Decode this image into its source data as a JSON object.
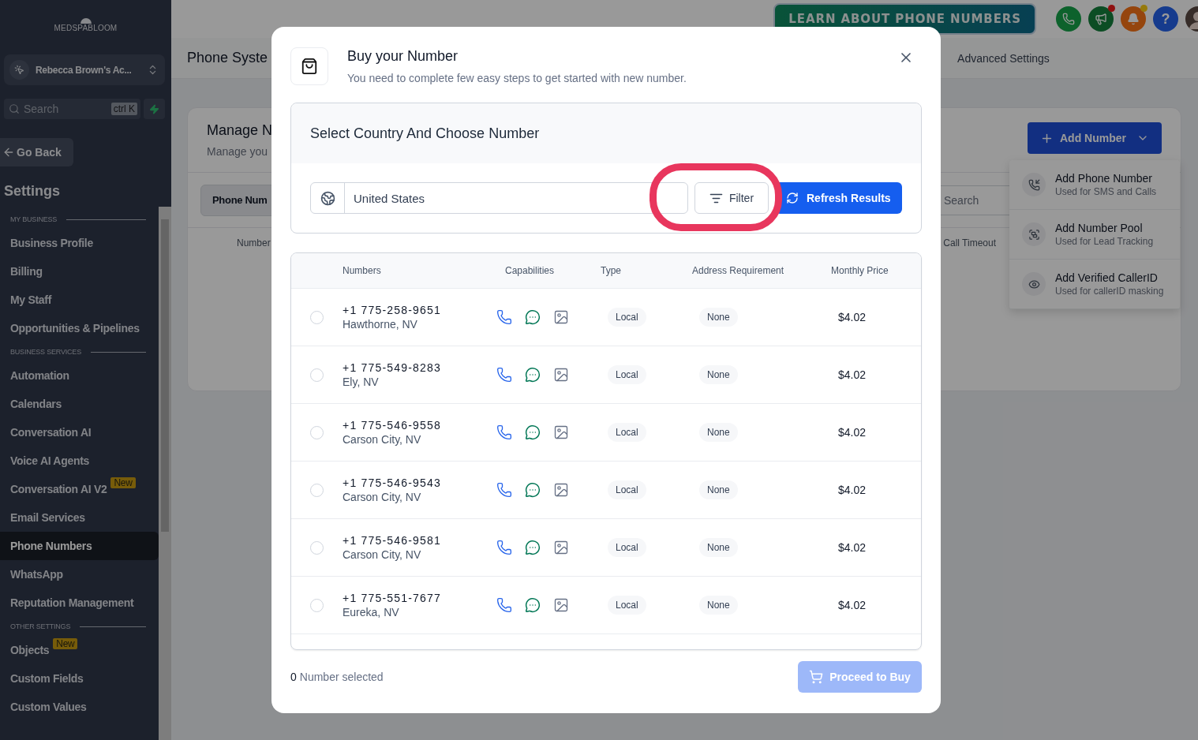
{
  "sidebar": {
    "logo": "MEDSPABLOOM",
    "account": "Rebecca Brown's Ac...",
    "search": {
      "placeholder": "Search",
      "shortcut": "ctrl K"
    },
    "back": "Go Back",
    "title": "Settings",
    "sections": [
      {
        "heading": "MY BUSINESS",
        "items": [
          {
            "label": "Business Profile",
            "selected": false
          },
          {
            "label": "Billing",
            "selected": false
          },
          {
            "label": "My Staff",
            "selected": false
          },
          {
            "label": "Opportunities & Pipelines",
            "selected": false
          }
        ]
      },
      {
        "heading": "BUSINESS SERVICES",
        "items": [
          {
            "label": "Automation",
            "selected": false
          },
          {
            "label": "Calendars",
            "selected": false
          },
          {
            "label": "Conversation AI",
            "selected": false
          },
          {
            "label": "Voice AI Agents",
            "selected": false
          },
          {
            "label": "Conversation AI V2",
            "badge": "New",
            "selected": false
          },
          {
            "label": "Email Services",
            "selected": false
          },
          {
            "label": "Phone Numbers",
            "selected": true
          },
          {
            "label": "WhatsApp",
            "selected": false
          },
          {
            "label": "Reputation Management",
            "selected": false
          }
        ]
      },
      {
        "heading": "OTHER SETTINGS",
        "items": [
          {
            "label": "Objects",
            "badge": "New",
            "selected": false
          },
          {
            "label": "Custom Fields",
            "selected": false
          },
          {
            "label": "Custom Values",
            "selected": false
          }
        ]
      }
    ]
  },
  "topbar": {
    "promo": "LEARN ABOUT PHONE NUMBERS",
    "help": "?"
  },
  "page": {
    "title": "Phone Syste",
    "tab": "Advanced Settings",
    "card": {
      "title": "Manage N",
      "subtitle": "Manage you",
      "segment": "Phone Num",
      "search": {
        "placeholder": "Search"
      },
      "columns": [
        "Number",
        "Call Timeout"
      ],
      "add_button": "Add Number",
      "menu": [
        {
          "kind": "phone",
          "title": "Add Phone Number",
          "subtitle": "Used for SMS and Calls"
        },
        {
          "kind": "pool",
          "title": "Add Number Pool",
          "subtitle": "Used for Lead Tracking"
        },
        {
          "kind": "callerid",
          "title": "Add Verified CallerID",
          "subtitle": "Used for callerID masking"
        }
      ]
    }
  },
  "modal": {
    "title": "Buy your Number",
    "subtitle": "You need to complete few easy steps to get started with new number.",
    "section_title": "Select Country And Choose Number",
    "country": "United States",
    "filter": "Filter",
    "refresh": "Refresh Results",
    "columns": [
      "Numbers",
      "Capabilities",
      "Type",
      "Address Requirement",
      "Monthly Price"
    ],
    "rows": [
      {
        "number": "+1 775-258-9651",
        "city": "Hawthorne, NV",
        "capabilities": {
          "voice": true,
          "sms": true,
          "mms": true
        },
        "type": "Local",
        "address": "None",
        "price": "$4.02",
        "selected": false
      },
      {
        "number": "+1 775-549-8283",
        "city": "Ely, NV",
        "capabilities": {
          "voice": true,
          "sms": true,
          "mms": true
        },
        "type": "Local",
        "address": "None",
        "price": "$4.02",
        "selected": false
      },
      {
        "number": "+1 775-546-9558",
        "city": "Carson City, NV",
        "capabilities": {
          "voice": true,
          "sms": true,
          "mms": true
        },
        "type": "Local",
        "address": "None",
        "price": "$4.02",
        "selected": false
      },
      {
        "number": "+1 775-546-9543",
        "city": "Carson City, NV",
        "capabilities": {
          "voice": true,
          "sms": true,
          "mms": true
        },
        "type": "Local",
        "address": "None",
        "price": "$4.02",
        "selected": false
      },
      {
        "number": "+1 775-546-9581",
        "city": "Carson City, NV",
        "capabilities": {
          "voice": true,
          "sms": true,
          "mms": true
        },
        "type": "Local",
        "address": "None",
        "price": "$4.02",
        "selected": false
      },
      {
        "number": "+1 775-551-7677",
        "city": "Eureka, NV",
        "capabilities": {
          "voice": true,
          "sms": true,
          "mms": true
        },
        "type": "Local",
        "address": "None",
        "price": "$4.02",
        "selected": false
      }
    ],
    "count": "0",
    "count_label": "Number selected",
    "buy": "Proceed to Buy",
    "buy_disabled": true
  }
}
